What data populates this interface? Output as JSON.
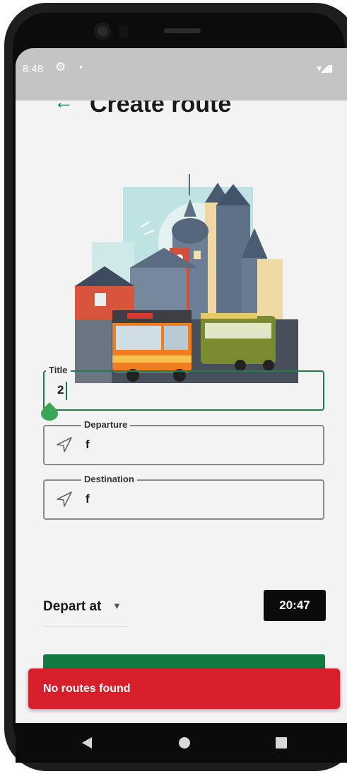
{
  "status_bar": {
    "time": "8:48",
    "gear_icon": "gear-icon",
    "dot": "•"
  },
  "header": {
    "back_icon": "back-arrow-icon",
    "title": "Create route"
  },
  "illustration": "city-bus-illustration",
  "form": {
    "title_field": {
      "label": "Title",
      "value": "2"
    },
    "departure_field": {
      "label": "Departure",
      "value": "f",
      "icon": "navigation-arrow-icon"
    },
    "destination_field": {
      "label": "Destination",
      "value": "f",
      "icon": "navigation-arrow-icon"
    }
  },
  "depart": {
    "label": "Depart at",
    "time": "20:47"
  },
  "snackbar": {
    "message": "No routes found"
  },
  "colors": {
    "accent": "#237a4a",
    "button": "#137a44",
    "error": "#d71f2c"
  }
}
